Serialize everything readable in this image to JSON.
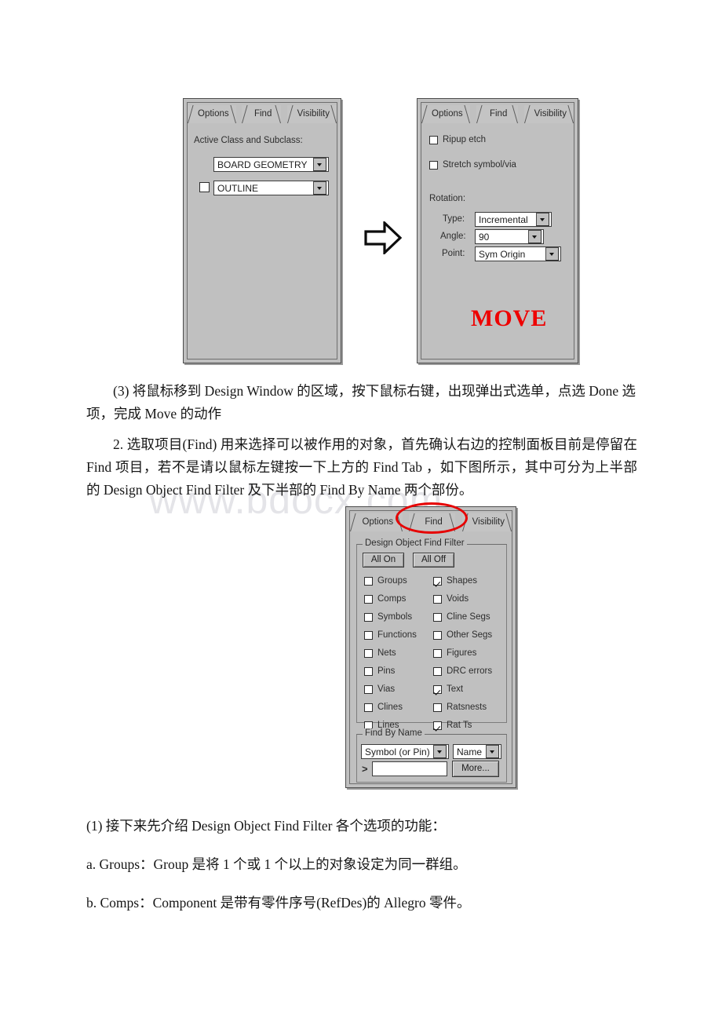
{
  "page": {
    "watermark": "www.bdocx.com",
    "background": "#ffffff"
  },
  "figure_move": {
    "caption_word": "MOVE",
    "arrow_icon": "right-block-arrow",
    "options_panel": {
      "tabs": [
        {
          "label": "Options",
          "active": true
        },
        {
          "label": "Find",
          "active": false
        },
        {
          "label": "Visibility",
          "active": false
        }
      ],
      "section_label": "Active Class and Subclass:",
      "class_combo": {
        "value": "BOARD GEOMETRY"
      },
      "subclass_checkbox": {
        "checked": false
      },
      "subclass_combo": {
        "value": "OUTLINE"
      }
    },
    "move_panel": {
      "tabs": [
        {
          "label": "Options",
          "active": true
        },
        {
          "label": "Find",
          "active": false
        },
        {
          "label": "Visibility",
          "active": false
        }
      ],
      "checkboxes": [
        {
          "label": "Ripup etch",
          "checked": false
        },
        {
          "label": "Stretch symbol/via",
          "checked": false
        }
      ],
      "rotation_label": "Rotation:",
      "rotation_fields": [
        {
          "label": "Type:",
          "value": "Incremental"
        },
        {
          "label": "Angle:",
          "value": "90"
        },
        {
          "label": "Point:",
          "value": "Sym Origin"
        }
      ]
    }
  },
  "figure_find": {
    "tabs": [
      {
        "label": "Options",
        "active": false
      },
      {
        "label": "Find",
        "active": true
      },
      {
        "label": "Visibility",
        "active": false
      }
    ],
    "highlight": {
      "target": "Find",
      "color": "#e60000"
    },
    "filter_group": {
      "title": "Design Object Find Filter",
      "buttons": [
        {
          "label": "All On"
        },
        {
          "label": "All Off"
        }
      ],
      "left_column": [
        {
          "label": "Groups",
          "checked": false
        },
        {
          "label": "Comps",
          "checked": false
        },
        {
          "label": "Symbols",
          "checked": false
        },
        {
          "label": "Functions",
          "checked": false
        },
        {
          "label": "Nets",
          "checked": false
        },
        {
          "label": "Pins",
          "checked": false
        },
        {
          "label": "Vias",
          "checked": false
        },
        {
          "label": "Clines",
          "checked": false
        },
        {
          "label": "Lines",
          "checked": false
        }
      ],
      "right_column": [
        {
          "label": "Shapes",
          "checked": true
        },
        {
          "label": "Voids",
          "checked": false
        },
        {
          "label": "Cline Segs",
          "checked": false
        },
        {
          "label": "Other Segs",
          "checked": false
        },
        {
          "label": "Figures",
          "checked": false
        },
        {
          "label": "DRC errors",
          "checked": false
        },
        {
          "label": "Text",
          "checked": true
        },
        {
          "label": "Ratsnests",
          "checked": false
        },
        {
          "label": "Rat Ts",
          "checked": true
        }
      ]
    },
    "find_by_name": {
      "title": "Find By Name",
      "type_combo": {
        "value": "Symbol (or Pin)"
      },
      "match_combo": {
        "value": "Name"
      },
      "expander_icon": ">",
      "name_input": {
        "value": "",
        "placeholder": ""
      },
      "more_button": {
        "label": "More..."
      }
    }
  },
  "body_text": {
    "p1": "(3) 将鼠标移到 Design Window 的区域，按下鼠标右键，出现弹出式选单，点选 Done 选项，完成 Move 的动作",
    "p2": "2. 选取项目(Find) 用来选择可以被作用的对象，首先确认右边的控制面板目前是停留在 Find 项目，若不是请以鼠标左键按一下上方的 Find Tab ，如下图所示，其中可分为上半部的 Design Object Find Filter 及下半部的 Find By Name 两个部份。",
    "p3": "(1) 接下来先介绍 Design Object Find Filter 各个选项的功能：",
    "p4": "a. Groups：Group 是将 1 个或 1 个以上的对象设定为同一群组。",
    "p5": "b. Comps：Component 是带有零件序号(RefDes)的 Allegro 零件。"
  }
}
